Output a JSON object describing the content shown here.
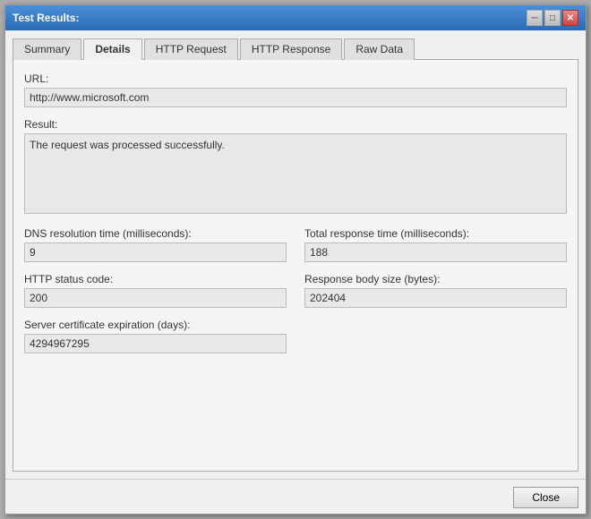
{
  "window": {
    "title": "Test Results:",
    "title_close_symbol": "✕",
    "title_min_symbol": "─",
    "title_max_symbol": "□"
  },
  "tabs": [
    {
      "label": "Summary",
      "underline_index": 0,
      "active": false
    },
    {
      "label": "Details",
      "underline_index": 0,
      "active": true
    },
    {
      "label": "HTTP Request",
      "underline_index": 0,
      "active": false
    },
    {
      "label": "HTTP Response",
      "underline_index": 0,
      "active": false
    },
    {
      "label": "Raw Data",
      "underline_index": 0,
      "active": false
    }
  ],
  "fields": {
    "url_label": "URL:",
    "url_value": "http://www.microsoft.com",
    "result_label": "Result:",
    "result_value": "The request was processed successfully.",
    "dns_label": "DNS resolution time (milliseconds):",
    "dns_underline": "D",
    "dns_value": "9",
    "total_response_label": "Total response time (milliseconds):",
    "total_response_underline": "T",
    "total_response_value": "188",
    "http_status_label": "HTTP status code:",
    "http_status_underline": "H",
    "http_status_value": "200",
    "response_body_label": "Response body size (bytes):",
    "response_body_underline": "b",
    "response_body_value": "202404",
    "server_cert_label": "Server certificate expiration (days):",
    "server_cert_underline": "e",
    "server_cert_value": "4294967295"
  },
  "footer": {
    "close_button_label": "Close"
  }
}
